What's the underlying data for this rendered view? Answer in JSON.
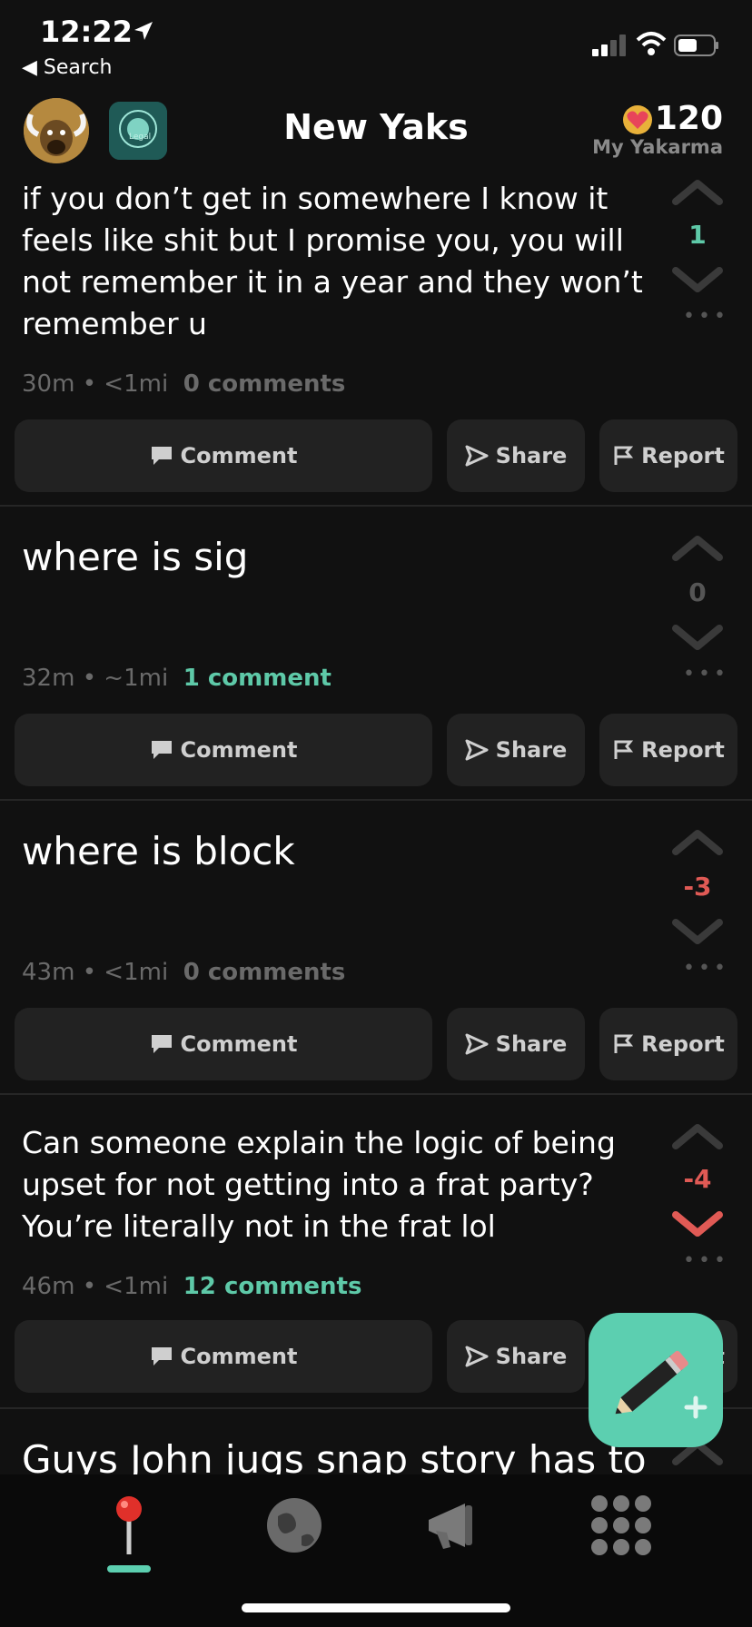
{
  "status": {
    "time": "12:22",
    "back_label": "◀ Search"
  },
  "header": {
    "title": "New Yaks",
    "karma_value": "120",
    "karma_label": "My Yakarma",
    "community_icon_text": "Legal"
  },
  "posts": [
    {
      "text": "if you don’t get in somewhere I know it feels like shit but I promise you, you will not remember it in a year and they won’t remember u",
      "age": "30m",
      "distance": "<1mi",
      "comments": "0 comments",
      "score": "1",
      "score_color": "#5ec9a8"
    },
    {
      "text": "where is sig",
      "age": "32m",
      "distance": "~1mi",
      "comments": "1 comment",
      "score": "0",
      "score_color": "#555555"
    },
    {
      "text": "where is block",
      "age": "43m",
      "distance": "<1mi",
      "comments": "0 comments",
      "score": "-3",
      "score_color": "#e05a55"
    },
    {
      "text": "Can someone explain the logic of being upset for not getting into a frat party? You’re literally not in the frat lol",
      "age": "46m",
      "distance": "<1mi",
      "comments": "12 comments",
      "score": "-4",
      "score_color": "#e05a55"
    },
    {
      "text": "Guys John jugs snap story has to"
    }
  ],
  "actions": {
    "comment": "Comment",
    "share": "Share",
    "report": "Report"
  },
  "meta_separator": "•",
  "dots": "•••",
  "colors": {
    "accent": "#5ccfb0",
    "negative": "#e05a55",
    "background": "#111111"
  },
  "nav": {
    "items": [
      "map-pin-icon",
      "globe-icon",
      "megaphone-icon",
      "grid-icon"
    ],
    "active": 0
  }
}
